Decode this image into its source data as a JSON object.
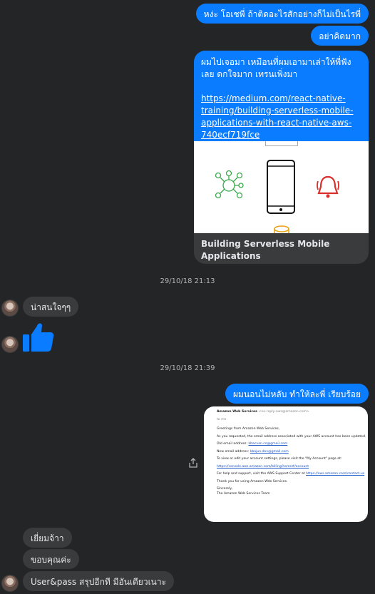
{
  "messages": {
    "out1": "หง่ะ โอเชพี่ ถ้าติดอะไรสักอย่างก็ไม่เป็นไรพี่",
    "out2": "อย่าคิดมาก",
    "card": {
      "message": "ผมไปเจอมา เหมือนที่ผมเอามาเล่าให้พี่ฟัง\nเลย ดกใจมาก เทรนเพิ่งมา",
      "message_line1": "ผมไปเจอมา เหมือนที่ผมเอามาเล่าให้พี่ฟัง",
      "message_line2": "เลย ดกใจมาก เทรนเพิ่งมา",
      "link": "https://medium.com/react-native-\ntraining/building-serverless-mobile-\napplications-with-react-native-aws-\n740ecf719fce",
      "preview_title": "Building Serverless Mobile Applications\nwith React Native & AWS"
    },
    "ts1": "29/10/18 21:13",
    "inc1": "น่าสนใจๆๆ",
    "ts2": "29/10/18 21:39",
    "out3": "ผมนอนไม่หลับ ทำให้ละพี่ เรียบร้อย",
    "email": {
      "sender": "Amazon Web Services",
      "sender_addr": "<no-reply-aws@amazon.com>",
      "to": "to me",
      "line1": "Greetings from Amazon Web Services,",
      "line2": "As you requested, the email address associated with your AWS account has been updated.",
      "old_label": "Old email address:",
      "old_value": "kbacvan.co@gmail.com",
      "new_label": "New email address:",
      "new_value": "kbajun.dev@gmail.com",
      "line3": "To view or edit your account settings, please visit the \"My Account\" page at:",
      "url1": "https://console.aws.amazon.com/billing/home#/account",
      "line4": "For help and support, visit the AWS Support Center at",
      "url2": "https://aws.amazon.com/contact-us",
      "line5": "Thank you for using Amazon Web Services.",
      "closing": "Sincerely,",
      "signature": "The Amazon Web Services Team"
    },
    "inc2": "เยี่ยมจ้าา",
    "inc3": "ขอบคุณค่ะ",
    "inc4": "User&pass สรุปอีกที มีอันเดียวเนาะ"
  },
  "colors": {
    "background": "#242526",
    "outgoing": "#0a7cff",
    "incoming": "#3a3b3c",
    "like": "#0a7cff"
  },
  "icons": [
    "like-icon",
    "share-icon",
    "phone-icon",
    "bell-icon",
    "network-icon",
    "database-icon"
  ]
}
